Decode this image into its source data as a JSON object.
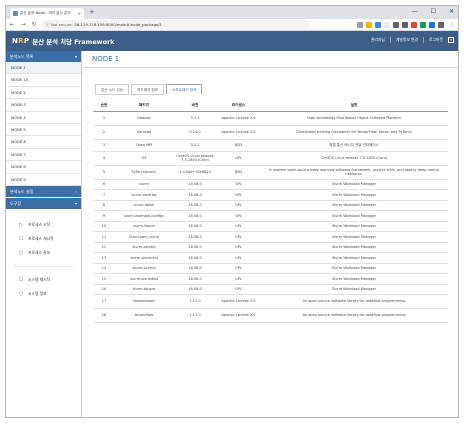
{
  "browser": {
    "tab_title": "분산 분석 Node - 머지 분산 분석",
    "tab_close": "×",
    "new_tab": "+",
    "window_controls": [
      "—",
      "☐",
      "✕"
    ],
    "back": "←",
    "forward": "→",
    "reload": "↻",
    "lock_text": "ⓘ Not secure",
    "url": "58.119.116.156:8000/main#/node_package/1",
    "menu": "⋮"
  },
  "app": {
    "logo_a": "N",
    "logo_b": "R",
    "logo_c": "P",
    "title": "분산 분석 처당 Framework",
    "user_menu": "관리자님",
    "settings": "개발정보 변경",
    "logout": "로그아웃",
    "extension_colors": [
      "#9aa0a6",
      "#f4b400",
      "#4285f4",
      "#e8eaed",
      "#5f6368",
      "#5f6368",
      "#db4437",
      "#0f9d58",
      "#1a73e8",
      "#5f6368"
    ]
  },
  "sidebar": {
    "node_list_header": "분석노드 목록",
    "nodes": [
      "NODE 1",
      "NODE 10",
      "NODE 2",
      "NODE 3",
      "NODE 4",
      "NODE 5",
      "NODE 6",
      "NODE 7",
      "NODE 8",
      "NODE 9"
    ],
    "settings_header": "분석노드 설정",
    "tools_header": "도구함",
    "tools": [
      {
        "icon": "▷",
        "label": "프로세스 시작"
      },
      {
        "icon": "☐",
        "label": "프로세스 재시작"
      },
      {
        "icon": "○",
        "label": "프로세스 정보"
      }
    ],
    "system": [
      {
        "icon": "☐",
        "label": "시스템 재시작"
      },
      {
        "icon": "○",
        "label": "시스템 정보"
      }
    ]
  },
  "main": {
    "title": "NODE 1",
    "tabs": [
      "분산 노드 성능",
      "하드웨어 정보",
      "소프트웨어 정보"
    ],
    "active_tab": 2,
    "columns": [
      "순번",
      "패키지",
      "버전",
      "라이센스",
      "설명"
    ],
    "rows": [
      [
        "1",
        "Hadoop",
        "3.1.1",
        "Apache License 2.0",
        "High Availability Distributed Object-Oriented Platform"
      ],
      [
        "2",
        "Horovod",
        "0.14.0",
        "Apache License 2.0",
        "Distributed training framework for TensorFlow, Keras, and PyTorch"
      ],
      [
        "3",
        "Open MPI",
        "3.1.2",
        "BSD",
        "병렬 통신 메시지 전달 인터페이스"
      ],
      [
        "4",
        "OS",
        "CentOS Linux release 7.5.1804 (Core)",
        "GPL",
        "CentOS Linux release 7.5.1804 (Core)"
      ],
      [
        "5",
        "PyTorch(torch)",
        "1.0.0a0+54e8623",
        "BSD",
        "A modern open-source deep learning software framework, used to train, and deploy deep neural networks."
      ],
      [
        "6",
        "slurm",
        "18.08.0",
        "GPL",
        "Slurm Workload Manager"
      ],
      [
        "7",
        "slurm-contribs",
        "18.08.0",
        "GPL",
        "Slurm Workload Manager"
      ],
      [
        "8",
        "slurm-devel",
        "18.08.0",
        "GPL",
        "Slurm Workload Manager"
      ],
      [
        "9",
        "slurm-example-configs",
        "18.08.0",
        "GPL",
        "Slurm Workload Manager"
      ],
      [
        "10",
        "slurm-libpmi",
        "18.08.0",
        "GPL",
        "Slurm Workload Manager"
      ],
      [
        "11",
        "slurm-pam_slurm",
        "18.08.0",
        "GPL",
        "Slurm Workload Manager"
      ],
      [
        "12",
        "slurm-perlapi",
        "18.08.0",
        "GPL",
        "Slurm Workload Manager"
      ],
      [
        "13",
        "slurm-slurmctld",
        "18.08.0",
        "GPL",
        "Slurm Workload Manager"
      ],
      [
        "14",
        "slurm-slurmd",
        "18.08.0",
        "GPL",
        "Slurm Workload Manager"
      ],
      [
        "15",
        "slurm-slurmdbd",
        "18.08.0",
        "GPL",
        "Slurm Workload Manager"
      ],
      [
        "16",
        "slurm-torque",
        "18.08.0",
        "GPL",
        "Slurm Workload Manager"
      ],
      [
        "17",
        "tensorboard",
        "1.11.0",
        "Apache License 2.0",
        "An open-source software library for dataflow programming"
      ],
      [
        "18",
        "tensorflow",
        "1.11.0",
        "Apache License 2.0",
        "An open-source software library for dataflow programming"
      ]
    ]
  }
}
